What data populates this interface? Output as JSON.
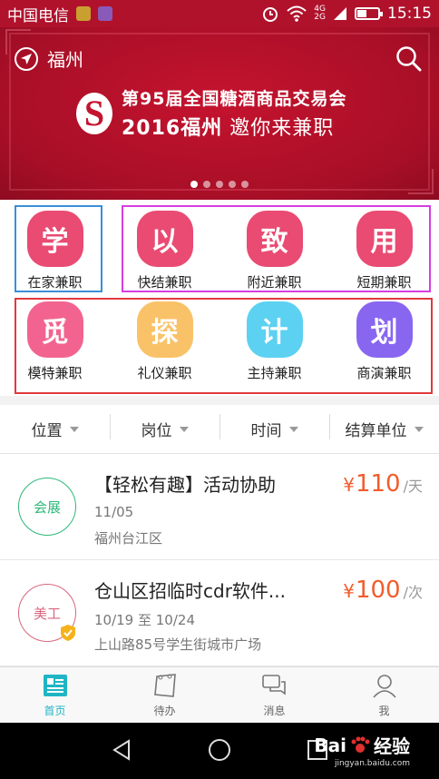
{
  "status": {
    "carrier": "中国电信",
    "time": "15:15",
    "net": "4G",
    "net2": "2G"
  },
  "header": {
    "city": "福州",
    "icons": [
      "location-arrow-icon",
      "search-icon"
    ]
  },
  "banner": {
    "line1": "第95届全国糖酒商品交易会",
    "line2_bold": "2016福州",
    "line2_rest": " 邀你来兼职",
    "page_index": 1,
    "page_count": 5
  },
  "categories": [
    {
      "glyph": "学",
      "label": "在家兼职",
      "color": "#e94b73"
    },
    {
      "glyph": "以",
      "label": "快结兼职",
      "color": "#e94b73"
    },
    {
      "glyph": "致",
      "label": "附近兼职",
      "color": "#e94b73"
    },
    {
      "glyph": "用",
      "label": "短期兼职",
      "color": "#e94b73"
    },
    {
      "glyph": "觅",
      "label": "模特兼职",
      "color": "#f2648f"
    },
    {
      "glyph": "探",
      "label": "礼仪兼职",
      "color": "#f9c268"
    },
    {
      "glyph": "计",
      "label": "主持兼职",
      "color": "#5cd1f1"
    },
    {
      "glyph": "划",
      "label": "商演兼职",
      "color": "#8866f0"
    }
  ],
  "highlight_colors": {
    "blue": "#3a8fd8",
    "magenta": "#d63ee0",
    "red": "#e0393e"
  },
  "filters": [
    "位置",
    "岗位",
    "时间",
    "结算单位"
  ],
  "jobs": [
    {
      "badge": "会展",
      "badge_color": "#2eb87a",
      "title": "【轻松有趣】活动协助",
      "date": "11/05",
      "address": "福州台江区",
      "currency": "¥",
      "price": "110",
      "unit": "/天",
      "verified": false
    },
    {
      "badge": "美工",
      "badge_color": "#d9667e",
      "title": "仓山区招临时cdr软件...",
      "date": "10/19 至 10/24",
      "address": "上山路85号学生街城市广场",
      "currency": "¥",
      "price": "100",
      "unit": "/次",
      "verified": true
    }
  ],
  "tabs": [
    {
      "label": "首页",
      "icon": "home-icon",
      "active": true
    },
    {
      "label": "待办",
      "icon": "todo-icon",
      "active": false
    },
    {
      "label": "消息",
      "icon": "message-icon",
      "active": false
    },
    {
      "label": "我",
      "icon": "profile-icon",
      "active": false
    }
  ],
  "watermark": {
    "brand": "Bai",
    "suffix": "经验",
    "url": "jingyan.baidu.com"
  }
}
